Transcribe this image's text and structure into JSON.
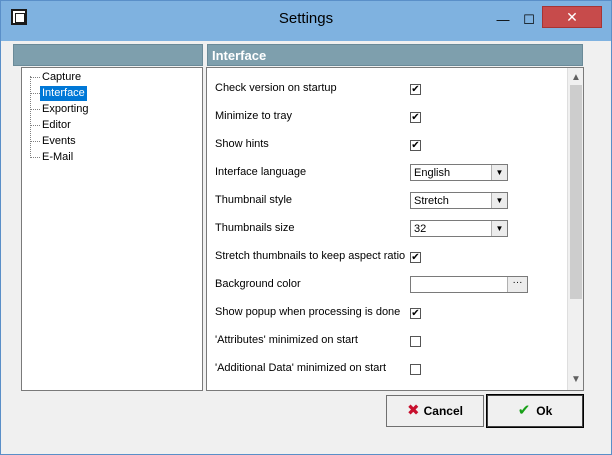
{
  "window": {
    "title": "Settings"
  },
  "titlebar": {
    "minimize": "—",
    "maximize": "☐",
    "close": "✕"
  },
  "tree": {
    "items": [
      {
        "label": "Capture",
        "selected": false
      },
      {
        "label": "Interface",
        "selected": true
      },
      {
        "label": "Exporting",
        "selected": false
      },
      {
        "label": "Editor",
        "selected": false
      },
      {
        "label": "Events",
        "selected": false
      },
      {
        "label": "E-Mail",
        "selected": false
      }
    ]
  },
  "panel": {
    "title": "Interface",
    "options": [
      {
        "label": "Check version on startup",
        "type": "checkbox",
        "checked": true,
        "mark": "✔"
      },
      {
        "label": "Minimize to tray",
        "type": "checkbox",
        "checked": true,
        "mark": "✔"
      },
      {
        "label": "Show hints",
        "type": "checkbox",
        "checked": true,
        "mark": "✔"
      },
      {
        "label": "Interface language",
        "type": "select",
        "value": "English"
      },
      {
        "label": "Thumbnail style",
        "type": "select",
        "value": "Stretch"
      },
      {
        "label": "Thumbnails size",
        "type": "select",
        "value": "32"
      },
      {
        "label": "Stretch thumbnails to keep aspect ratio",
        "type": "checkbox",
        "checked": true,
        "mark": "✔"
      },
      {
        "label": "Background color",
        "type": "color",
        "value": "",
        "button": "···"
      },
      {
        "label": "Show popup when processing is done",
        "type": "checkbox",
        "checked": true,
        "mark": "✔"
      },
      {
        "label": "'Attributes' minimized on start",
        "type": "checkbox",
        "checked": false,
        "mark": ""
      },
      {
        "label": "'Additional Data' minimized on start",
        "type": "checkbox",
        "checked": false,
        "mark": ""
      }
    ]
  },
  "scroll": {
    "up": "▲",
    "down": "▼"
  },
  "buttons": {
    "cancel": "Cancel",
    "cancel_icon": "✖",
    "ok": "Ok",
    "ok_icon": "✔"
  },
  "icons": {
    "app": "app-icon",
    "cancel": "cancel-x-icon",
    "ok": "ok-check-icon"
  },
  "colors": {
    "header": "#7e9fad",
    "titlebar": "#7fb2e0",
    "selection": "#0078d7",
    "close": "#c74b4b"
  }
}
